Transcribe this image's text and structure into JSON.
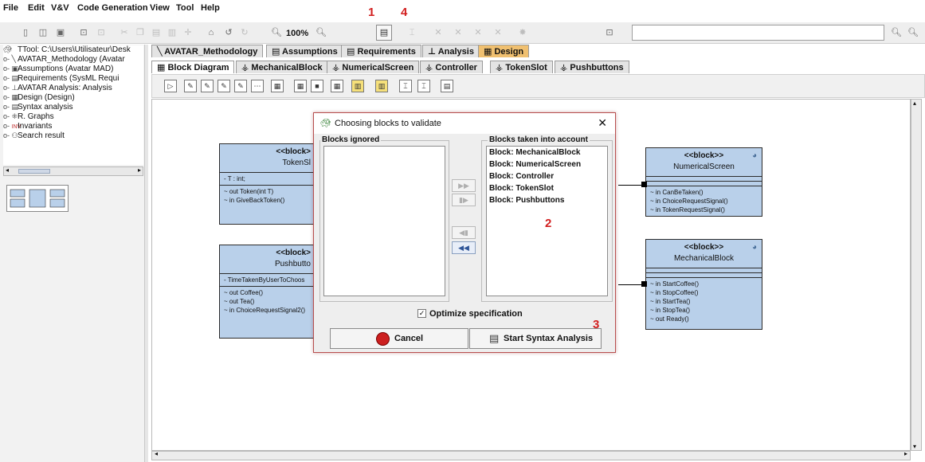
{
  "menu": [
    "File",
    "Edit",
    "V&V",
    "Code Generation",
    "View",
    "Tool",
    "Help"
  ],
  "toolbar": {
    "zoom": "100%"
  },
  "annotations": {
    "m1": "1",
    "m2": "2",
    "m3": "3",
    "m4": "4"
  },
  "tree": {
    "items": [
      "TTool: C:\\Users\\Utilisateur\\Desk",
      "AVATAR_Methodology (Avatar",
      "Assumptions (Avatar MAD)",
      "Requirements (SysML Requi",
      "AVATAR Analysis: Analysis",
      "Design (Design)",
      "Syntax analysis",
      "R. Graphs",
      "Invariants",
      "Search result"
    ],
    "invariants_icon": "INV"
  },
  "tabs": [
    "AVATAR_Methodology",
    "Assumptions",
    "Requirements",
    "Analysis",
    "Design"
  ],
  "subtabs": [
    "Block Diagram",
    "MechanicalBlock",
    "NumericalScreen",
    "Controller",
    "TokenSlot",
    "Pushbuttons"
  ],
  "blocks": {
    "token": {
      "stereo": "<<block>",
      "name": "TokenSl",
      "attr": "- T : int;",
      "methods": [
        "~ out Token(int T)",
        "~ in GiveBackToken()"
      ]
    },
    "push": {
      "stereo": "<<block>",
      "name": "Pushbutto",
      "attr": "- TimeTakenByUserToChoos",
      "methods": [
        "~ out Coffee()",
        "~ out Tea()",
        "~ in ChoiceRequestSignal2()"
      ]
    },
    "numerical": {
      "stereo": "<<block>>",
      "name": "NumericalScreen",
      "methods": [
        "~ in CanBeTaken()",
        "~ in ChoiceRequestSignal()",
        "~ in TokenRequestSignal()"
      ]
    },
    "mechanical": {
      "stereo": "<<block>>",
      "name": "MechanicalBlock",
      "methods": [
        "~ in StartCoffee()",
        "~ in StopCoffee()",
        "~ in StartTea()",
        "~ in StopTea()",
        "~ out Ready()"
      ]
    }
  },
  "dialog": {
    "title": "Choosing blocks to validate",
    "ignored_label": "Blocks ignored",
    "taken_label": "Blocks taken into account",
    "taken": [
      "Block: MechanicalBlock",
      "Block: NumericalScreen",
      "Block: Controller",
      "Block: TokenSlot",
      "Block: Pushbuttons"
    ],
    "optimize_label": "Optimize specification",
    "optimize_checked": true,
    "cancel_label": "Cancel",
    "start_label": "Start Syntax Analysis"
  },
  "colors": {
    "block_fill": "#b9d0ea",
    "design_tab": "#f0c070",
    "annotation": "#d21f1f"
  }
}
